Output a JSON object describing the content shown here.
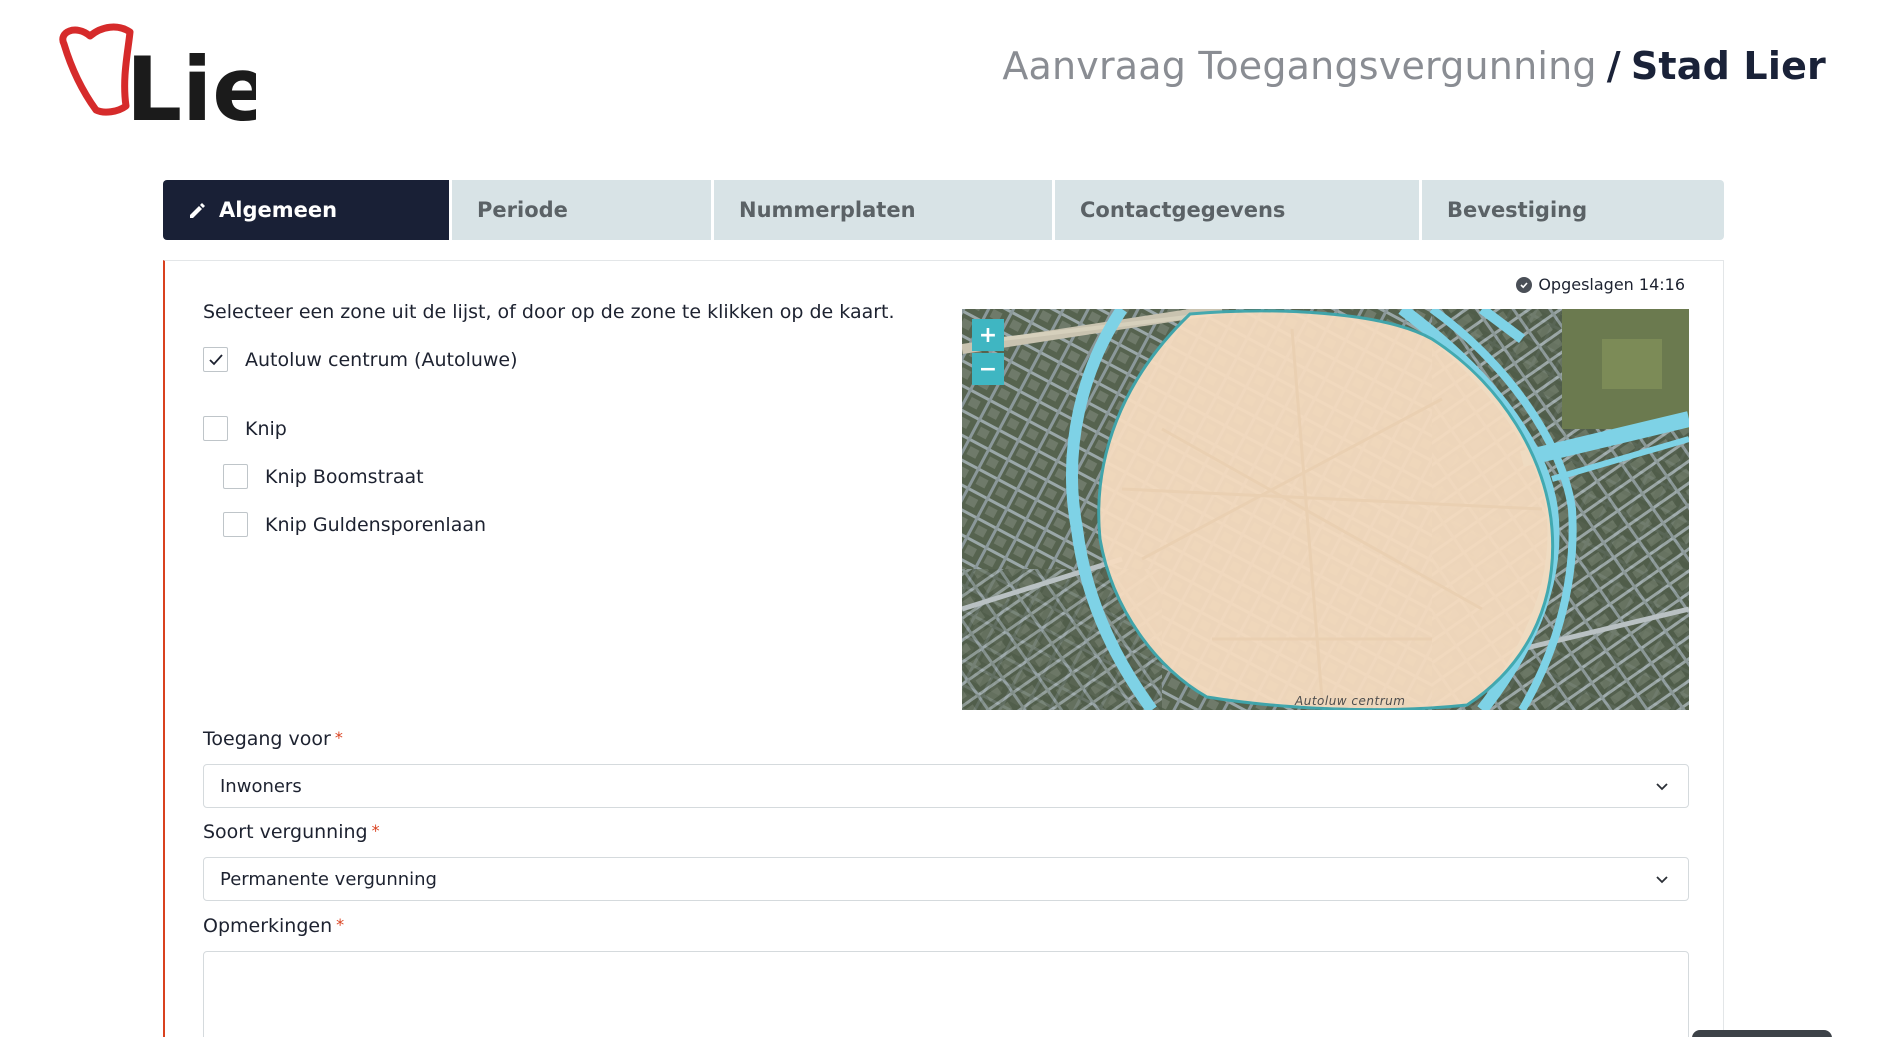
{
  "header": {
    "logo_text": "Lier",
    "title_light": "Aanvraag Toegangsvergunning",
    "title_separator": "/",
    "title_strong": "Stad Lier"
  },
  "tabs": [
    {
      "label": "Algemeen",
      "icon": "pencil-icon",
      "active": true
    },
    {
      "label": "Periode",
      "active": false
    },
    {
      "label": "Nummerplaten",
      "active": false
    },
    {
      "label": "Contactgegevens",
      "active": false
    },
    {
      "label": "Bevestiging",
      "active": false
    }
  ],
  "status": {
    "saved_text": "Opgeslagen 14:16",
    "icon": "check-circle-icon"
  },
  "zones": {
    "intro": "Selecteer een zone uit de lijst, of door op de zone te klikken op de kaart.",
    "items": [
      {
        "label": "Autoluw centrum (Autoluwe)",
        "checked": true
      },
      {
        "label": "Knip",
        "checked": false
      },
      {
        "label": "Knip Boomstraat",
        "checked": false
      },
      {
        "label": "Knip Guldensporenlaan",
        "checked": false
      }
    ]
  },
  "map": {
    "zoom_in": "+",
    "zoom_out": "−",
    "zone_label": "Autoluw centrum"
  },
  "form": {
    "access_label": "Toegang voor",
    "access_value": "Inwoners",
    "permit_label": "Soort vergunning",
    "permit_value": "Permanente vergunning",
    "remarks_label": "Opmerkingen",
    "remarks_value": "",
    "required_mark": "*"
  },
  "colors": {
    "brand_dark": "#192036",
    "tab_inactive": "#d8e3e6",
    "accent_red": "#d9411f",
    "map_zone_fill": "#f6dcc0",
    "water": "#7ed2e6"
  }
}
